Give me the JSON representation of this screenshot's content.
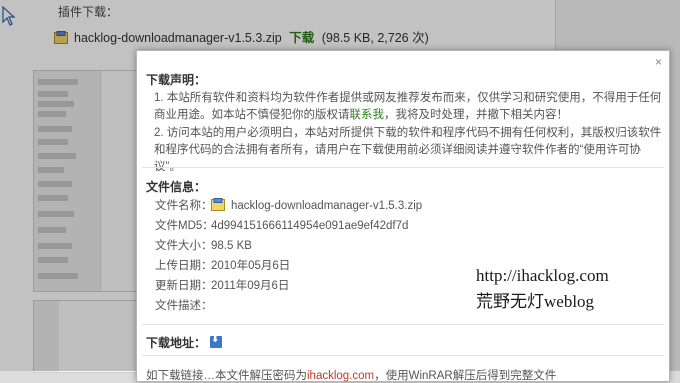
{
  "background": {
    "plugin_download_label": "插件下载：",
    "file_name": "hacklog-downloadmanager-v1.5.3.zip",
    "download_label": "下载",
    "file_meta": "(98.5 KB, 2,726 次)"
  },
  "dialog": {
    "close": "×",
    "disclaimer": {
      "title": "下载声明：",
      "p1_text": "1. 本站所有软件和资料均为软件作者提供或网友推荐发布而来，仅供学习和研究使用，不得用于任何商业用途。如本站不慎侵犯你的版权请",
      "p1_link": "联系我",
      "p1_tail": "，我将及时处理，并撤下相关内容！",
      "p2_text": "2. 访问本站的用户必须明白，本站对所提供下载的软件和程序代码不拥有任何权利，其版权归该软件和程序代码的合法拥有者所有，请用户在下载使用前必须详细阅读并遵守软件作者的“使用许可协议”。"
    },
    "file_info": {
      "title": "文件信息：",
      "rows": [
        {
          "key": "文件名称：",
          "value": "hacklog-downloadmanager-v1.5.3.zip",
          "icon": "zip-icon"
        },
        {
          "key": "文件MD5：",
          "value": "4d994151666114954e091ae9ef42df7d"
        },
        {
          "key": "文件大小：",
          "value": "98.5 KB"
        },
        {
          "key": "上传日期：",
          "value": "2010年05月6日"
        },
        {
          "key": "更新日期：",
          "value": "2011年09月6日"
        },
        {
          "key": "文件描述：",
          "value": ""
        }
      ]
    },
    "download_address": {
      "title": "下载地址：",
      "icon": "download-icon"
    },
    "cut_text": {
      "before": "如下载链接…本文件解压密码为",
      "red": "ihacklog.com",
      "after": "，使用WinRAR解压后得到完整文件"
    }
  },
  "watermark": {
    "url": "http://ihacklog.com",
    "name": "荒野无灯weblog"
  },
  "colors": {
    "link_green": "#2e7d1e",
    "download_blue": "#3a78c6",
    "overlay": "rgba(0,0,0,0.24)"
  }
}
